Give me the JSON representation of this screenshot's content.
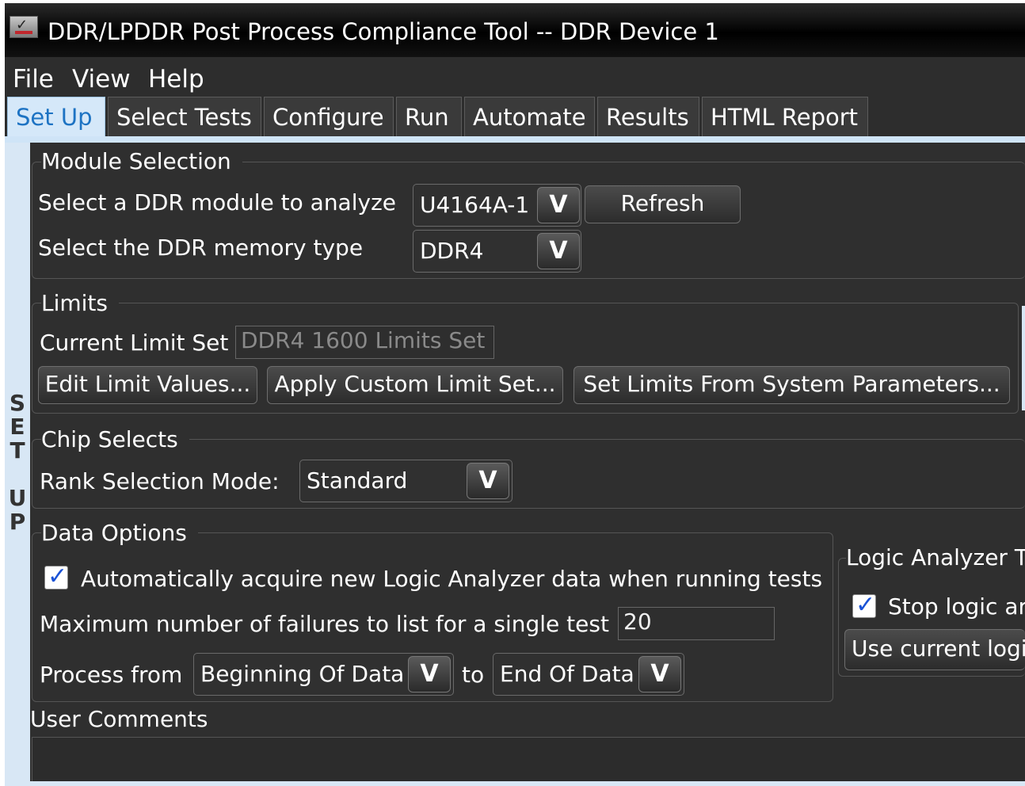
{
  "window": {
    "title": "DDR/LPDDR Post Process Compliance Tool -- DDR Device 1"
  },
  "menu": [
    "File",
    "View",
    "Help"
  ],
  "tabs": [
    "Set Up",
    "Select Tests",
    "Configure",
    "Run",
    "Automate",
    "Results",
    "HTML Report"
  ],
  "active_tab": "Set Up",
  "side_label": [
    "S",
    "E",
    "T",
    "",
    "U",
    "P"
  ],
  "module_selection": {
    "title": "Module Selection",
    "module_label": "Select a DDR module to analyze",
    "module_value": "U4164A-1",
    "refresh_label": "Refresh",
    "memory_type_label": "Select the DDR memory type",
    "memory_type_value": "DDR4"
  },
  "limits": {
    "title": "Limits",
    "current_label": "Current Limit Set",
    "current_value": "DDR4 1600 Limits Set",
    "edit_button": "Edit Limit Values...",
    "apply_button": "Apply Custom Limit Set...",
    "system_button": "Set Limits From System Parameters..."
  },
  "chip_selects": {
    "title": "Chip Selects",
    "rank_label": "Rank Selection Mode:",
    "rank_value": "Standard"
  },
  "data_options": {
    "title": "Data Options",
    "auto_acquire_label": "Automatically acquire new Logic Analyzer data when running tests",
    "auto_acquire_checked": true,
    "max_failures_label": "Maximum number of failures to list for a single test",
    "max_failures_value": "20",
    "process_from_label": "Process from",
    "process_from_value": "Beginning Of Data",
    "to_label": "to",
    "process_to_value": "End Of Data"
  },
  "logic_analyzer": {
    "title": "Logic Analyzer T",
    "stop_label": "Stop logic ar",
    "stop_checked": true,
    "use_current_label": "Use current logi"
  },
  "user_comments": {
    "title": "User Comments",
    "value": ""
  },
  "colors": {
    "background": "#2f2f2f",
    "active_tab_bg": "#d5e8f9",
    "active_tab_text": "#1d73c3",
    "readonly_text": "#8a8a8a",
    "check_color": "#1a52d6"
  }
}
